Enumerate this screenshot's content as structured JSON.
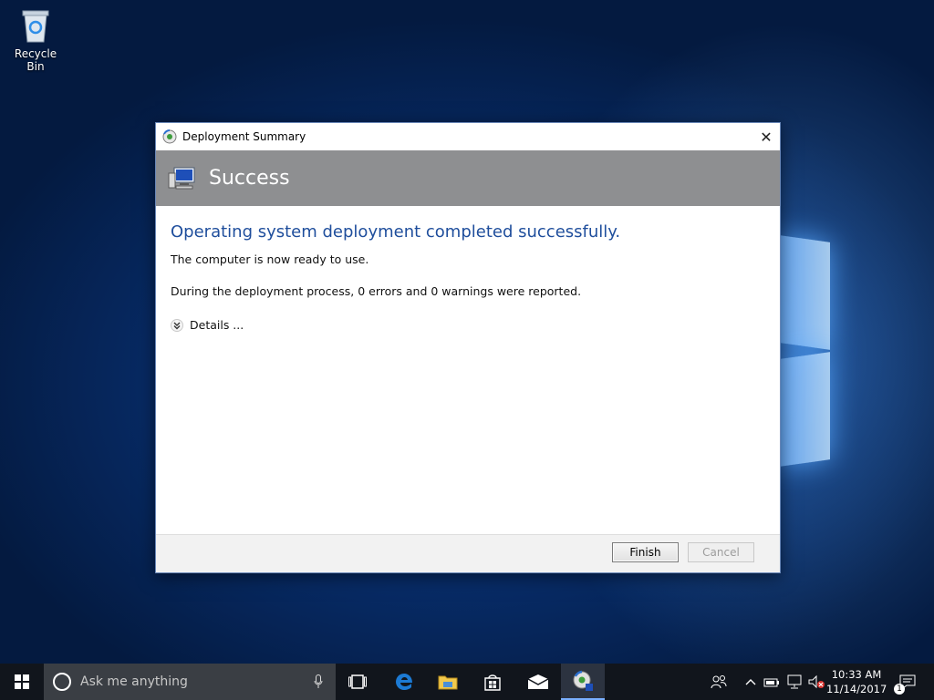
{
  "desktop": {
    "recycle_bin_label": "Recycle Bin"
  },
  "dialog": {
    "title": "Deployment Summary",
    "banner_text": "Success",
    "headline": "Operating system deployment completed successfully.",
    "ready_text": "The computer is now ready to use.",
    "report_text": "During the deployment process, 0 errors and 0 warnings were reported.",
    "details_label": "Details ...",
    "finish_label": "Finish",
    "cancel_label": "Cancel",
    "colors": {
      "headline": "#1f4e9c",
      "banner": "#8e8f91"
    }
  },
  "taskbar": {
    "search_placeholder": "Ask me anything",
    "clock_time": "10:33 AM",
    "clock_date": "11/14/2017",
    "notification_count": "1",
    "pinned": [
      "task-view-icon",
      "edge-icon",
      "file-explorer-icon",
      "store-icon",
      "mail-icon",
      "deployment-wizard-icon"
    ]
  }
}
